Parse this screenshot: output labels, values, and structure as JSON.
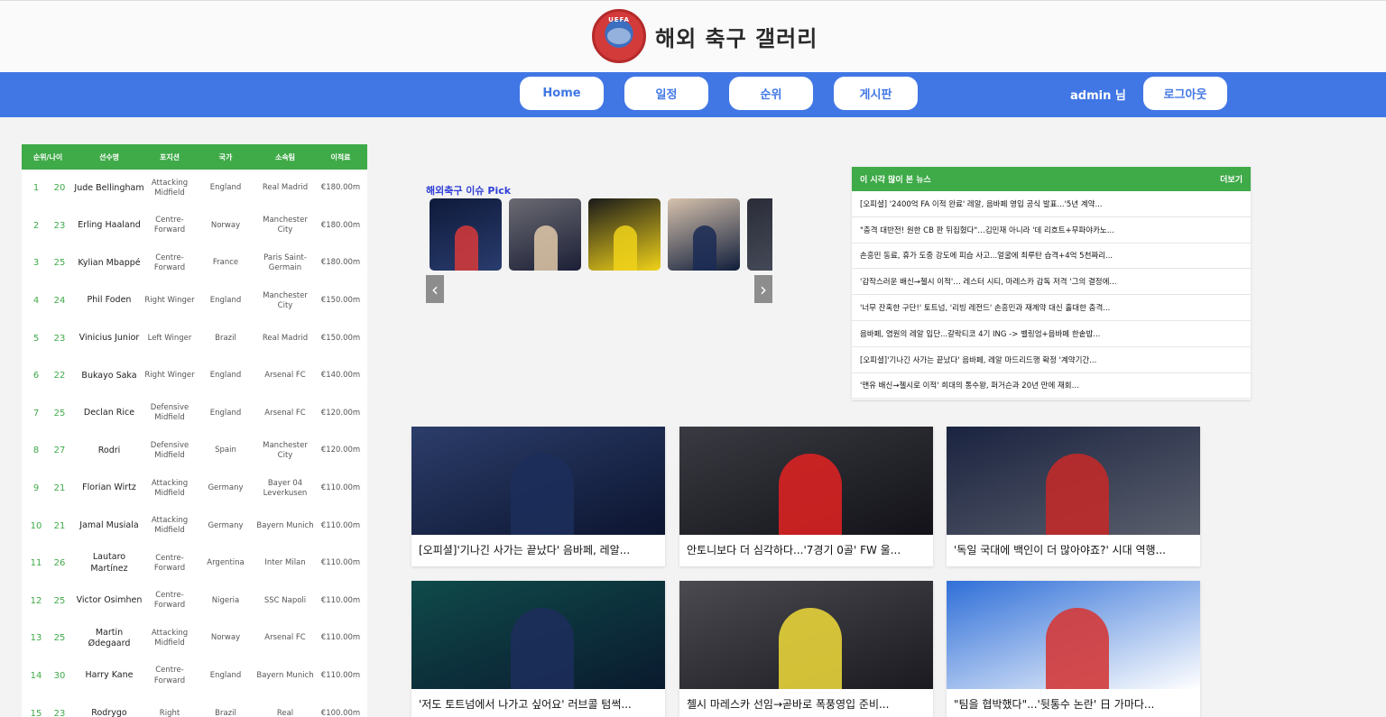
{
  "header": {
    "logo_text": "UEFA",
    "title": "해외 축구 갤러리"
  },
  "nav": {
    "home": "Home",
    "schedule": "일정",
    "standings": "순위",
    "board": "게시판",
    "user": "admin 님",
    "logout": "로그아웃"
  },
  "rankings": {
    "headers": [
      "순위/나이",
      "선수명",
      "포지션",
      "국가",
      "소속팀",
      "이적료"
    ],
    "rows": [
      {
        "rank": "1",
        "age": "20",
        "name": "Jude Bellingham",
        "pos": "Attacking Midfield",
        "nation": "England",
        "club": "Real Madrid",
        "fee": "€180.00m"
      },
      {
        "rank": "2",
        "age": "23",
        "name": "Erling Haaland",
        "pos": "Centre-Forward",
        "nation": "Norway",
        "club": "Manchester City",
        "fee": "€180.00m"
      },
      {
        "rank": "3",
        "age": "25",
        "name": "Kylian Mbappé",
        "pos": "Centre-Forward",
        "nation": "France",
        "club": "Paris Saint-Germain",
        "fee": "€180.00m"
      },
      {
        "rank": "4",
        "age": "24",
        "name": "Phil Foden",
        "pos": "Right Winger",
        "nation": "England",
        "club": "Manchester City",
        "fee": "€150.00m"
      },
      {
        "rank": "5",
        "age": "23",
        "name": "Vinicius Junior",
        "pos": "Left Winger",
        "nation": "Brazil",
        "club": "Real Madrid",
        "fee": "€150.00m"
      },
      {
        "rank": "6",
        "age": "22",
        "name": "Bukayo Saka",
        "pos": "Right Winger",
        "nation": "England",
        "club": "Arsenal FC",
        "fee": "€140.00m"
      },
      {
        "rank": "7",
        "age": "25",
        "name": "Declan Rice",
        "pos": "Defensive Midfield",
        "nation": "England",
        "club": "Arsenal FC",
        "fee": "€120.00m"
      },
      {
        "rank": "8",
        "age": "27",
        "name": "Rodri",
        "pos": "Defensive Midfield",
        "nation": "Spain",
        "club": "Manchester City",
        "fee": "€120.00m"
      },
      {
        "rank": "9",
        "age": "21",
        "name": "Florian Wirtz",
        "pos": "Attacking Midfield",
        "nation": "Germany",
        "club": "Bayer 04 Leverkusen",
        "fee": "€110.00m"
      },
      {
        "rank": "10",
        "age": "21",
        "name": "Jamal Musiala",
        "pos": "Attacking Midfield",
        "nation": "Germany",
        "club": "Bayern Munich",
        "fee": "€110.00m"
      },
      {
        "rank": "11",
        "age": "26",
        "name": "Lautaro Martínez",
        "pos": "Centre-Forward",
        "nation": "Argentina",
        "club": "Inter Milan",
        "fee": "€110.00m"
      },
      {
        "rank": "12",
        "age": "25",
        "name": "Victor Osimhen",
        "pos": "Centre-Forward",
        "nation": "Nigeria",
        "club": "SSC Napoli",
        "fee": "€110.00m"
      },
      {
        "rank": "13",
        "age": "25",
        "name": "Martin Ødegaard",
        "pos": "Attacking Midfield",
        "nation": "Norway",
        "club": "Arsenal FC",
        "fee": "€110.00m"
      },
      {
        "rank": "14",
        "age": "30",
        "name": "Harry Kane",
        "pos": "Centre-Forward",
        "nation": "England",
        "club": "Bayern Munich",
        "fee": "€110.00m"
      },
      {
        "rank": "15",
        "age": "23",
        "name": "Rodrygo",
        "pos": "Right",
        "nation": "Brazil",
        "club": "Real",
        "fee": "€100.00m"
      }
    ]
  },
  "pick": {
    "title": "해외축구 이슈 Pick",
    "thumbs": [
      {
        "colors": [
          "#0e1a3a",
          "#2a3c6e"
        ],
        "accent": "#d83a3a"
      },
      {
        "colors": [
          "#6a6a72",
          "#1c1f36"
        ],
        "accent": "#e0c9a8"
      },
      {
        "colors": [
          "#1a1a1a",
          "#f0d21a"
        ],
        "accent": "#f0d21a"
      },
      {
        "colors": [
          "#d7c2ad",
          "#0f1d3a"
        ],
        "accent": "#1a2a55"
      },
      {
        "colors": [
          "#2a2d38",
          "#4a4f5e"
        ],
        "accent": "#8a8a8a"
      }
    ],
    "prev": "‹",
    "next": "›"
  },
  "news": {
    "title": "이 시각 많이 본 뉴스",
    "more": "더보기",
    "items": [
      "[오피셜] '2400억 FA 이적 완료' 레알, 음바페 영입 공식 발표...'5년 계약...",
      "\"충격 대반전! 원한 CB 판 뒤집혔다\"…김민재 아니라 '데 리흐트+무파야카노...",
      "손흥민 동료, 휴가 도중 강도에 피습 사고...얼굴에 최루탄 습격+4억 5천짜리...",
      "'감작스러운 배신→첼시 이적'… 레스터 시티, 마레스카 감독 저격 '그의 결정에...",
      "'너무 잔혹한 구단!' 토트넘, '리빙 레전드' 손흥민과 재계약 대신 홀대한 충격...",
      "음바페, 염원의 레알 입단...갈락티코 4기 ING -> 벨링엄+음바페 한솥밥...",
      "[오피셜]'기나긴 사가는 끝났다' 음바페, 레알 마드리드행 확정 '계약기간...",
      "'맨유 배신→첼시로 이적' 희대의 통수왕, 퍼거슨과 20년 만에 재회..."
    ]
  },
  "cards": [
    {
      "caption": "[오피셜]'기나긴 사가는 끝났다' 음바페, 레알...",
      "colors": [
        "#2c3d6a",
        "#0c1530"
      ],
      "accent": "#1c2d5a"
    },
    {
      "caption": "안토니보다 더 심각하다...'7경기 0골' FW 울...",
      "colors": [
        "#3a3a42",
        "#121218"
      ],
      "accent": "#d92222"
    },
    {
      "caption": "'독일 국대에 백인이 더 많아야죠?' 시대 역행...",
      "colors": [
        "#1a2340",
        "#5a5f6c"
      ],
      "accent": "#c02a2a"
    },
    {
      "caption": "'저도 토트넘에서 나가고 싶어요' 러브콜 텀썩...",
      "colors": [
        "#0f4a4a",
        "#0a1a2e"
      ],
      "accent": "#1c2d5a"
    },
    {
      "caption": "첼시 마레스카 선임→곧바로 폭풍영입 준비...",
      "colors": [
        "#4a4a50",
        "#1a1a20"
      ],
      "accent": "#e6d23a"
    },
    {
      "caption": "\"팀을 협박했다\"...'뒷통수 논란' 日 가마다...",
      "colors": [
        "#2f6fd8",
        "#ffffff"
      ],
      "accent": "#d33a3a"
    }
  ]
}
